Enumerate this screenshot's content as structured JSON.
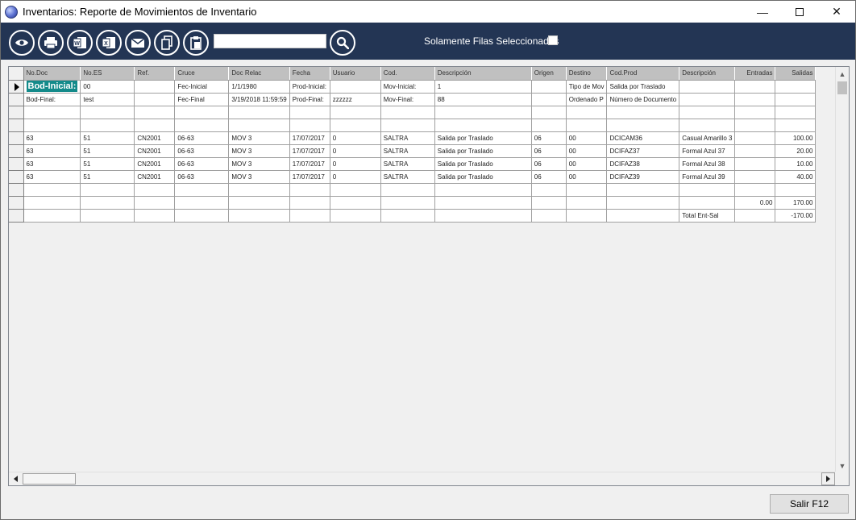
{
  "window": {
    "title": "Inventarios: Reporte de Movimientos de Inventario",
    "minimize_glyph": "—",
    "close_glyph": "✕"
  },
  "toolbar": {
    "buttons": [
      {
        "name": "eye-icon"
      },
      {
        "name": "printer-icon"
      },
      {
        "name": "word-icon"
      },
      {
        "name": "excel-icon"
      },
      {
        "name": "mail-icon"
      },
      {
        "name": "copy-icon"
      },
      {
        "name": "paste-icon"
      }
    ],
    "search_value": "",
    "search_icon": "search-icon",
    "selected_rows_label": "Solamente Filas Seleccionadas",
    "selected_rows_checked": false
  },
  "grid": {
    "columns": [
      "No.Doc",
      "No.ES",
      "Ref.",
      "Cruce",
      "Doc Relac",
      "Fecha",
      "Usuario",
      "Cod.",
      "Descripción",
      "Origen",
      "Destino",
      "Cod.Prod",
      "Descripción",
      "Entradas",
      "Salidas"
    ],
    "rows": [
      [
        "Bod-Inicial:",
        "00",
        "",
        "Fec-Inicial",
        "1/1/1980",
        "Prod-Inicial:",
        "",
        "Mov-Inicial:",
        "1",
        "",
        "Tipo de Mov",
        "Salida por Traslado",
        "",
        "",
        ""
      ],
      [
        "Bod-Final:",
        "test",
        "",
        "Fec-Final",
        "3/19/2018 11:59:59",
        "Prod-Final:",
        "zzzzzz",
        "Mov-Final:",
        "88",
        "",
        "Ordenado P",
        "Número de Documento",
        "",
        "",
        ""
      ],
      [
        "",
        "",
        "",
        "",
        "",
        "",
        "",
        "",
        "",
        "",
        "",
        "",
        "",
        "",
        ""
      ],
      [
        "",
        "",
        "",
        "",
        "",
        "",
        "",
        "",
        "",
        "",
        "",
        "",
        "",
        "",
        ""
      ],
      [
        "63",
        "51",
        "CN2001",
        "06-63",
        "MOV 3",
        "17/07/2017",
        "0",
        "SALTRA",
        "Salida por Traslado",
        "06",
        "00",
        "DCICAM36",
        "Casual Amarillo 3",
        "",
        "100.00"
      ],
      [
        "63",
        "51",
        "CN2001",
        "06-63",
        "MOV 3",
        "17/07/2017",
        "0",
        "SALTRA",
        "Salida por Traslado",
        "06",
        "00",
        "DCIFAZ37",
        "Formal Azul 37",
        "",
        "20.00"
      ],
      [
        "63",
        "51",
        "CN2001",
        "06-63",
        "MOV 3",
        "17/07/2017",
        "0",
        "SALTRA",
        "Salida por Traslado",
        "06",
        "00",
        "DCIFAZ38",
        "Formal Azul 38",
        "",
        "10.00"
      ],
      [
        "63",
        "51",
        "CN2001",
        "06-63",
        "MOV 3",
        "17/07/2017",
        "0",
        "SALTRA",
        "Salida por Traslado",
        "06",
        "00",
        "DCIFAZ39",
        "Formal Azul 39",
        "",
        "40.00"
      ],
      [
        "",
        "",
        "",
        "",
        "",
        "",
        "",
        "",
        "",
        "",
        "",
        "",
        "",
        "",
        ""
      ],
      [
        "",
        "",
        "",
        "",
        "",
        "",
        "",
        "",
        "",
        "",
        "",
        "",
        "",
        "0.00",
        "170.00"
      ],
      [
        "",
        "",
        "",
        "",
        "",
        "",
        "",
        "",
        "",
        "",
        "",
        "",
        "Total Ent-Sal",
        "",
        "-170.00"
      ]
    ],
    "current_row": 0,
    "selected_cell_color": "#138a8a"
  },
  "footer": {
    "exit_label": "Salir F12"
  },
  "colors": {
    "toolbar_bg": "#233554",
    "header_bg": "#c0c0c0"
  }
}
